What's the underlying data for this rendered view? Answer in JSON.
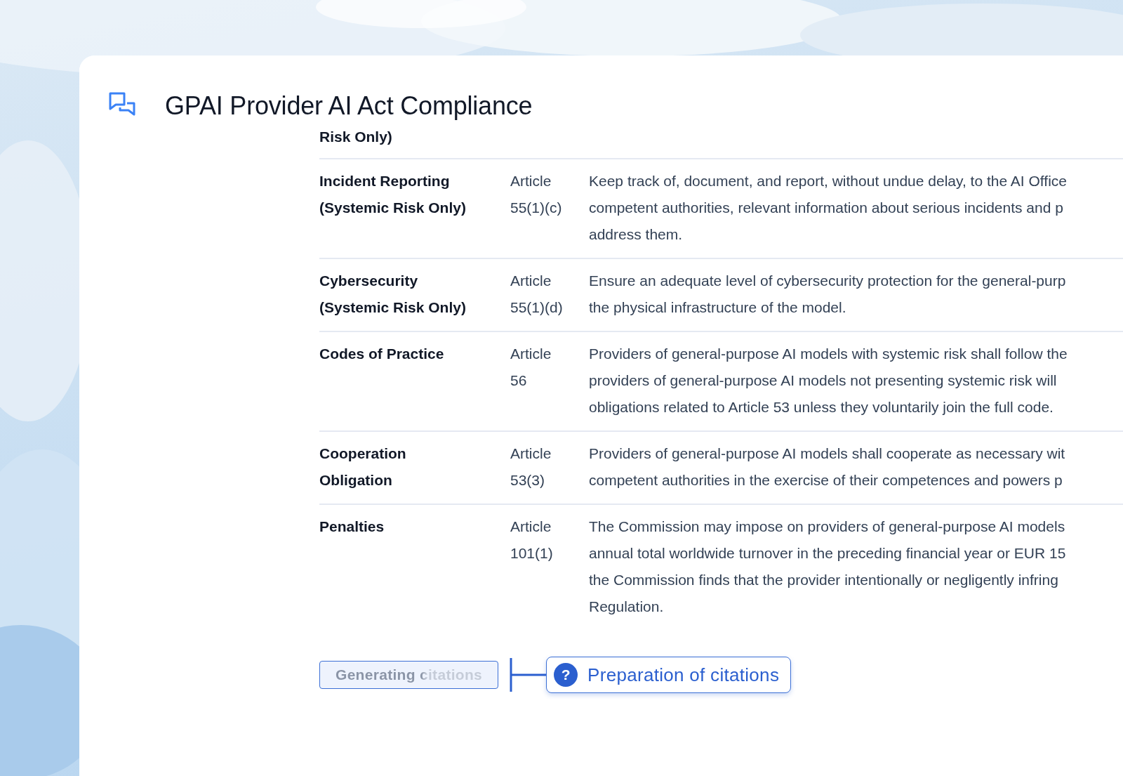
{
  "header": {
    "title": "GPAI Provider AI Act Compliance"
  },
  "table": {
    "partial_row": {
      "requirement": "Risk Only)"
    },
    "rows": [
      {
        "requirement": "Incident Reporting (Systemic Risk Only)",
        "article": "Article 55(1)(c)",
        "description": [
          "Keep track of, document, and report, without undue delay, to the AI Office",
          "competent authorities, relevant information about serious incidents and p",
          "address them."
        ]
      },
      {
        "requirement": "Cybersecurity (Systemic Risk Only)",
        "article": "Article 55(1)(d)",
        "description": [
          "Ensure an adequate level of cybersecurity protection for the general-purp",
          "the physical infrastructure of the model."
        ]
      },
      {
        "requirement": "Codes of Practice",
        "article": "Article 56",
        "description": [
          "Providers of general-purpose AI models with systemic risk shall follow the",
          "providers of general-purpose AI models not presenting systemic risk will",
          "obligations related to Article 53 unless they voluntarily join the full code."
        ]
      },
      {
        "requirement": "Cooperation Obligation",
        "article": "Article 53(3)",
        "description": [
          "Providers of general-purpose AI models shall cooperate as necessary wit",
          "competent authorities in the exercise of their competences and powers p"
        ]
      },
      {
        "requirement": "Penalties",
        "article": "Article 101(1)",
        "description": [
          "The Commission may impose on providers of general-purpose AI models",
          "annual total worldwide turnover in the preceding financial year or EUR 15",
          "the Commission finds that the provider intentionally or negligently infring",
          "Regulation."
        ]
      }
    ]
  },
  "progress": {
    "generating": "Generating citations",
    "step": {
      "icon": "?",
      "label": "Preparation of citations"
    }
  }
}
